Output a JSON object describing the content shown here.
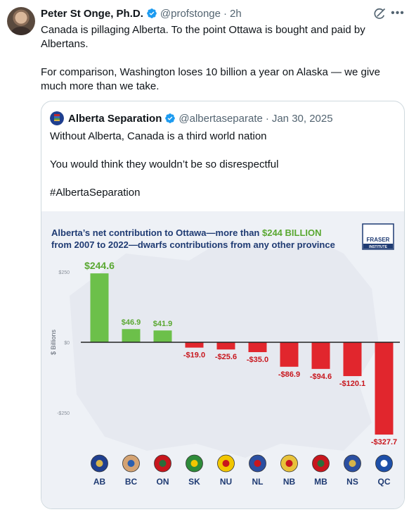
{
  "tweet": {
    "author_name": "Peter St Onge, Ph.D.",
    "handle": "@profstonge",
    "separator": "·",
    "time": "2h",
    "text_paragraphs": [
      "Canada is pillaging Alberta. To the point Ottawa is bought and paid by Albertans.",
      "For comparison, Washington loses 10 billion a year on Alaska — we give much more than we take."
    ],
    "icons": {
      "verified": "verified-badge-icon",
      "grok": "grok-icon",
      "more": "more-options-icon"
    }
  },
  "quote": {
    "author_name": "Alberta Separation",
    "handle": "@albertaseparate",
    "separator": "·",
    "date": "Jan 30, 2025",
    "text_paragraphs": [
      "Without Alberta, Canada is a third world nation",
      "You would think they wouldn’t be so disrespectful",
      "#AlbertaSeparation"
    ]
  },
  "chart_data": {
    "type": "bar",
    "title_line1_prefix": "Alberta’s net contribution to Ottawa—more than ",
    "title_highlight": "$244 BILLION",
    "title_line2": "from 2007 to 2022—dwarfs contributions from any other province",
    "logo_line1": "FRASER",
    "logo_line2": "INSTITUTE",
    "ylabel": "$ Billions",
    "yticks": [
      {
        "value": 250,
        "label": "$250"
      },
      {
        "value": 0,
        "label": "$0"
      },
      {
        "value": -250,
        "label": "-$250"
      }
    ],
    "ylim": [
      -327.7,
      244.6
    ],
    "categories": [
      "AB",
      "BC",
      "ON",
      "SK",
      "NU",
      "NL",
      "NB",
      "MB",
      "NS",
      "QC"
    ],
    "values": [
      244.6,
      46.9,
      41.9,
      -19.0,
      -25.6,
      -35.0,
      -86.9,
      -94.6,
      -120.1,
      -327.7
    ],
    "value_labels": [
      "$244.6",
      "$46.9",
      "$41.9",
      "-$19.0",
      "-$25.6",
      "-$35.0",
      "-$86.9",
      "-$94.6",
      "-$120.1",
      "-$327.7"
    ],
    "colors": {
      "positive": "#6cc04a",
      "negative": "#e1262d",
      "title": "#1f3b73",
      "highlight": "#5aa832",
      "category": "#1f3b73",
      "positive_label": "#5aa832",
      "negative_label": "#c8161d"
    },
    "grid": false,
    "legend": "none"
  }
}
